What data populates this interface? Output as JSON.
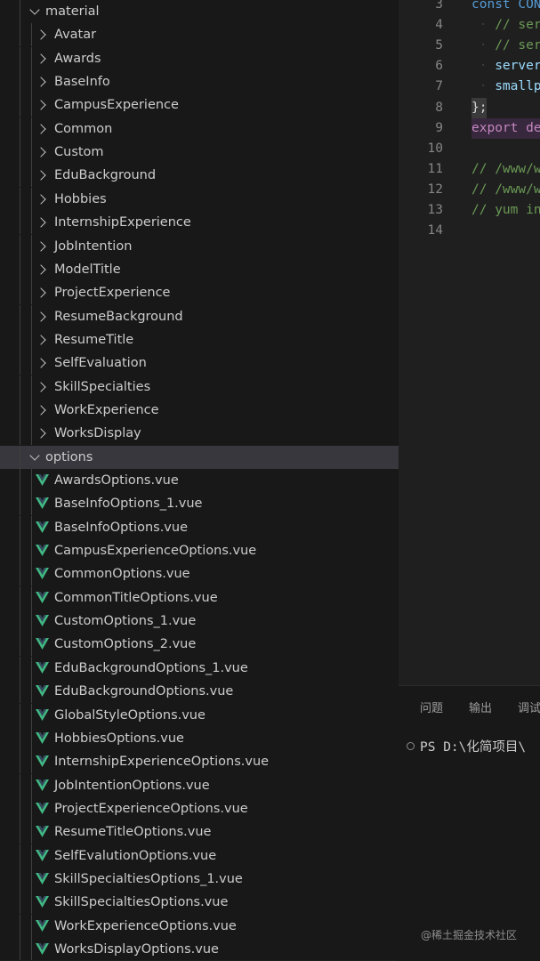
{
  "explorer": {
    "material_folder": "material",
    "material_items": [
      "Avatar",
      "Awards",
      "BaseInfo",
      "CampusExperience",
      "Common",
      "Custom",
      "EduBackground",
      "Hobbies",
      "InternshipExperience",
      "JobIntention",
      "ModelTitle",
      "ProjectExperience",
      "ResumeBackground",
      "ResumeTitle",
      "SelfEvaluation",
      "SkillSpecialties",
      "WorkExperience",
      "WorksDisplay"
    ],
    "options_folder": "options",
    "options_files": [
      "AwardsOptions.vue",
      "BaseInfoOptions_1.vue",
      "BaseInfoOptions.vue",
      "CampusExperienceOptions.vue",
      "CommonOptions.vue",
      "CommonTitleOptions.vue",
      "CustomOptions_1.vue",
      "CustomOptions_2.vue",
      "EduBackgroundOptions_1.vue",
      "EduBackgroundOptions.vue",
      "GlobalStyleOptions.vue",
      "HobbiesOptions.vue",
      "InternshipExperienceOptions.vue",
      "JobIntentionOptions.vue",
      "ProjectExperienceOptions.vue",
      "ResumeTitleOptions.vue",
      "SelfEvalutionOptions.vue",
      "SkillSpecialtiesOptions_1.vue",
      "SkillSpecialtiesOptions.vue",
      "WorkExperienceOptions.vue",
      "WorksDisplayOptions.vue"
    ],
    "file_icon": "vue-icon",
    "vue_icon_colors": {
      "outer": "#41b883",
      "inner": "#35495e"
    }
  },
  "editor": {
    "lines": [
      {
        "num": "3",
        "tokens": [
          {
            "t": "const",
            "c": "kw"
          },
          {
            "t": " CON",
            "c": "kw"
          }
        ]
      },
      {
        "num": "4",
        "tokens": [
          {
            "t": " · ",
            "c": "ws"
          },
          {
            "t": "// serv",
            "c": "cm"
          }
        ]
      },
      {
        "num": "5",
        "tokens": [
          {
            "t": " · ",
            "c": "ws"
          },
          {
            "t": "// serv",
            "c": "cm"
          }
        ]
      },
      {
        "num": "6",
        "tokens": [
          {
            "t": " · ",
            "c": "ws"
          },
          {
            "t": "server",
            "c": "pr"
          }
        ]
      },
      {
        "num": "7",
        "tokens": [
          {
            "t": " · ",
            "c": "ws"
          },
          {
            "t": "smallpi",
            "c": "pr"
          }
        ]
      },
      {
        "num": "8",
        "tokens": [
          {
            "t": "};",
            "c": "pn"
          }
        ]
      },
      {
        "num": "9",
        "tokens": [
          {
            "t": "export de",
            "c": "kw2"
          }
        ]
      },
      {
        "num": "10",
        "tokens": []
      },
      {
        "num": "11",
        "tokens": [
          {
            "t": "// /www/w",
            "c": "cm"
          }
        ]
      },
      {
        "num": "12",
        "tokens": [
          {
            "t": "// /www/w",
            "c": "cm"
          }
        ]
      },
      {
        "num": "13",
        "tokens": [
          {
            "t": "// yum in",
            "c": "cm"
          }
        ]
      },
      {
        "num": "14",
        "tokens": []
      }
    ]
  },
  "panel": {
    "tabs": [
      "问题",
      "输出",
      "调试"
    ],
    "terminal_prompt": "PS D:\\化简项目\\"
  },
  "watermark": "@稀土掘金技术社区"
}
